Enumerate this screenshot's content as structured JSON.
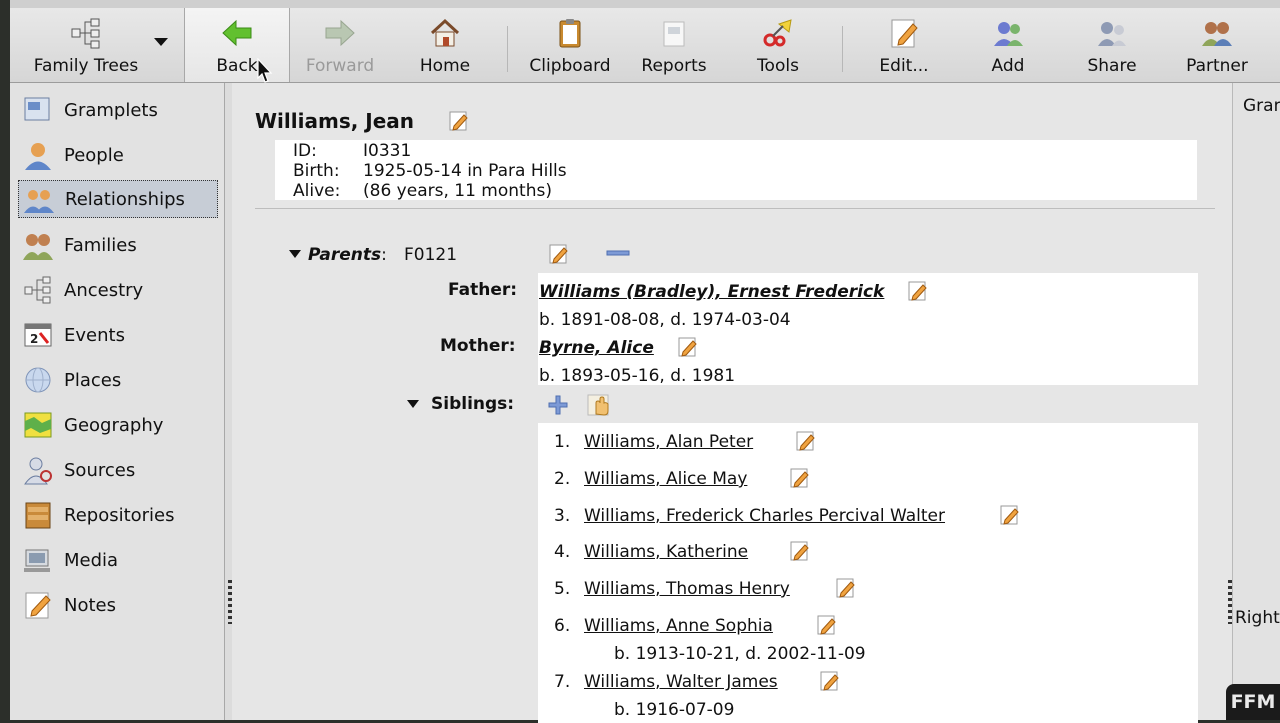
{
  "toolbar": {
    "family_trees": "Family Trees",
    "back": "Back",
    "forward": "Forward",
    "home": "Home",
    "clipboard": "Clipboard",
    "reports": "Reports",
    "tools": "Tools",
    "edit": "Edit...",
    "add": "Add",
    "share": "Share",
    "partner": "Partner"
  },
  "sidebar": {
    "items": [
      {
        "label": "Gramplets",
        "icon": "gramplets-icon"
      },
      {
        "label": "People",
        "icon": "person-icon"
      },
      {
        "label": "Relationships",
        "icon": "relationships-icon",
        "selected": true
      },
      {
        "label": "Families",
        "icon": "family-icon"
      },
      {
        "label": "Ancestry",
        "icon": "tree-icon"
      },
      {
        "label": "Events",
        "icon": "calendar-icon"
      },
      {
        "label": "Places",
        "icon": "globe-icon"
      },
      {
        "label": "Geography",
        "icon": "map-icon"
      },
      {
        "label": "Sources",
        "icon": "sources-icon"
      },
      {
        "label": "Repositories",
        "icon": "repository-icon"
      },
      {
        "label": "Media",
        "icon": "media-icon"
      },
      {
        "label": "Notes",
        "icon": "notes-icon"
      }
    ]
  },
  "person": {
    "name": "Williams, Jean",
    "id_label": "ID:",
    "id_value": "I0331",
    "birth_label": "Birth:",
    "birth_value": "1925-05-14 in Para Hills",
    "alive_label": "Alive:",
    "alive_value": "(86 years, 11 months)"
  },
  "parents": {
    "label": "Parents",
    "colon": ":",
    "family_id": "F0121",
    "father_label": "Father:",
    "father_name": "Williams (Bradley), Ernest Frederick",
    "father_dates": "b. 1891-08-08, d. 1974-03-04",
    "mother_label": "Mother:",
    "mother_name": "Byrne, Alice",
    "mother_dates": "b. 1893-05-16, d. 1981"
  },
  "siblings": {
    "label": "Siblings:",
    "items": [
      {
        "num": "1.",
        "name": "Williams, Alan Peter"
      },
      {
        "num": "2.",
        "name": "Williams, Alice May"
      },
      {
        "num": "3.",
        "name": "Williams, Frederick Charles Percival Walter"
      },
      {
        "num": "4.",
        "name": "Williams, Katherine"
      },
      {
        "num": "5.",
        "name": "Williams, Thomas Henry"
      },
      {
        "num": "6.",
        "name": "Williams, Anne Sophia",
        "dates": "b. 1913-10-21, d. 2002-11-09"
      },
      {
        "num": "7.",
        "name": "Williams, Walter James",
        "dates": "b. 1916-07-09"
      }
    ]
  },
  "right_panel": {
    "top_text": "Gran",
    "bottom_text": "Right"
  },
  "badge": "FFM",
  "colors": {
    "selected_bg": "#c7cdd6",
    "window_bg": "#dcdcdc",
    "edit_pencil": "#e07a1f"
  }
}
